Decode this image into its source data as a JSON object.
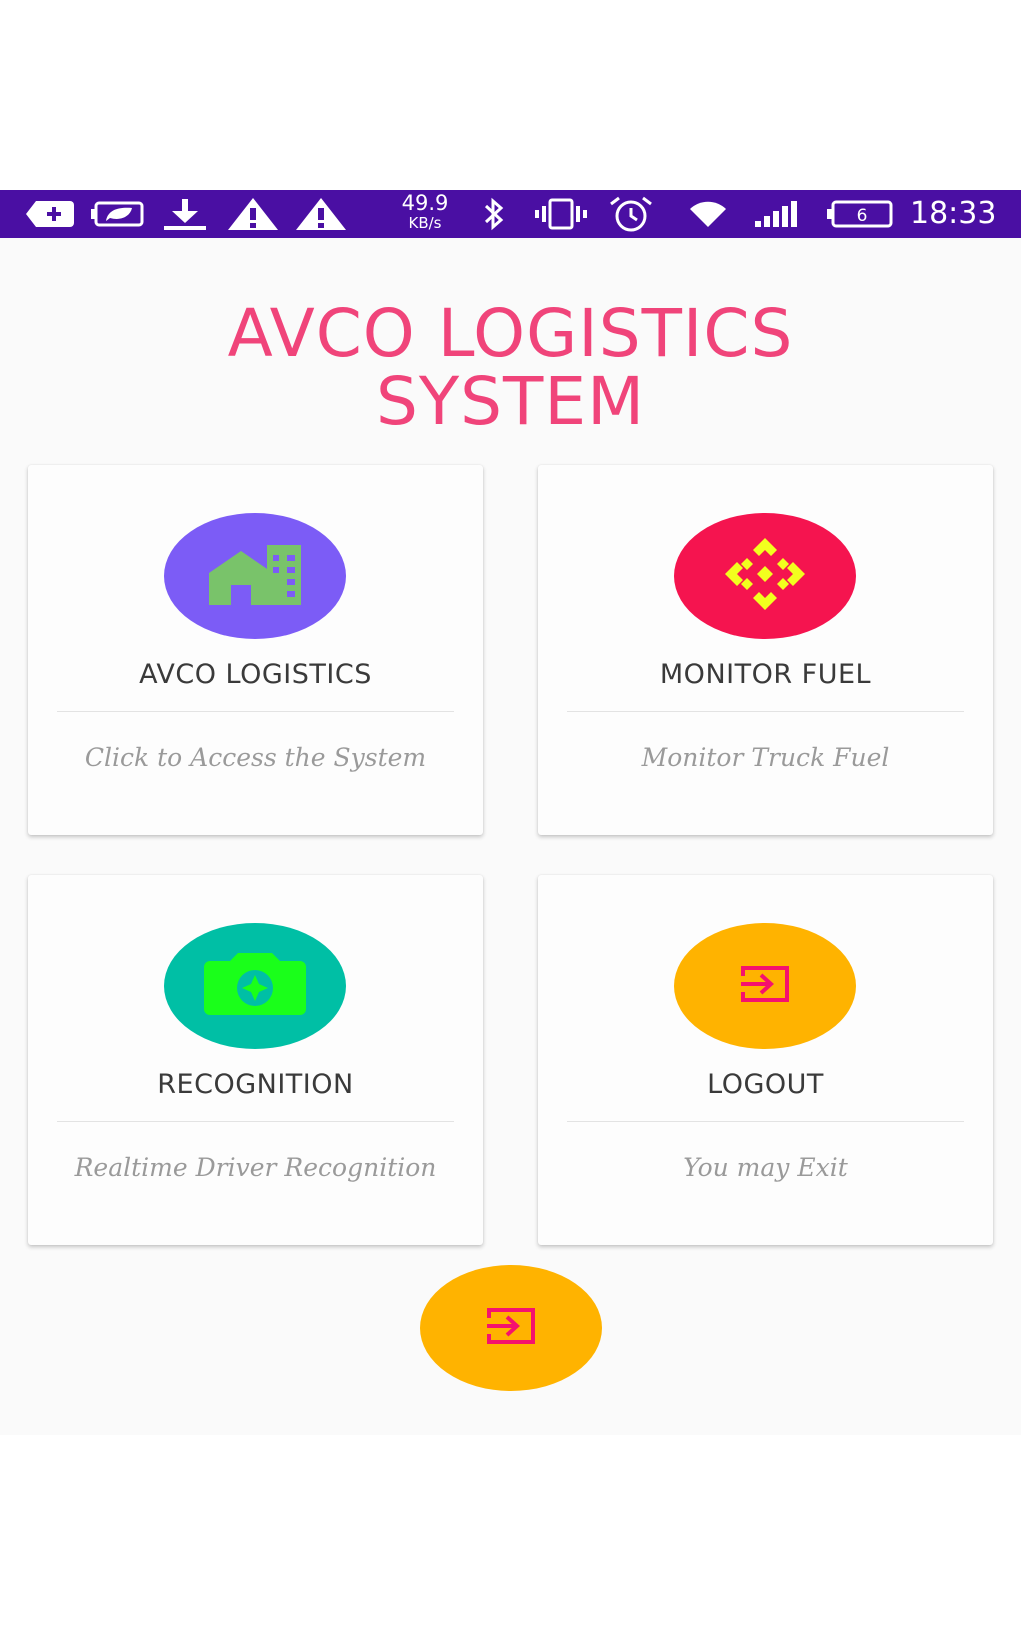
{
  "status_bar": {
    "net_speed_value": "49.9",
    "net_speed_unit": "KB/s",
    "battery_level": "6",
    "time": "18:33",
    "icons": [
      "plus-box-icon",
      "leaf-battery-icon",
      "download-icon",
      "warning-icon",
      "warning-icon",
      "bluetooth-icon",
      "vibrate-icon",
      "alarm-icon",
      "wifi-icon",
      "signal-icon",
      "battery-icon"
    ]
  },
  "app": {
    "title_line1": "AVCO LOGISTICS",
    "title_line2": "SYSTEM"
  },
  "cards": [
    {
      "title": "AVCO LOGISTICS",
      "subtitle": "Click to Access the System",
      "icon": "building-icon",
      "circle_color": "#7c5cf6"
    },
    {
      "title": "MONITOR FUEL",
      "subtitle": "Monitor Truck Fuel",
      "icon": "diamond-grid-icon",
      "circle_color": "#f5144f"
    },
    {
      "title": "RECOGNITION",
      "subtitle": "Realtime Driver Recognition",
      "icon": "camera-icon",
      "circle_color": "#00bfa5"
    },
    {
      "title": "LOGOUT",
      "subtitle": "You may Exit",
      "icon": "exit-icon",
      "circle_color": "#ffb300"
    }
  ],
  "fab": {
    "icon": "exit-icon",
    "color": "#ffb300"
  },
  "colors": {
    "status_bar": "#4a0fa3",
    "title": "#f0447a",
    "exit_icon": "#f5126e"
  }
}
